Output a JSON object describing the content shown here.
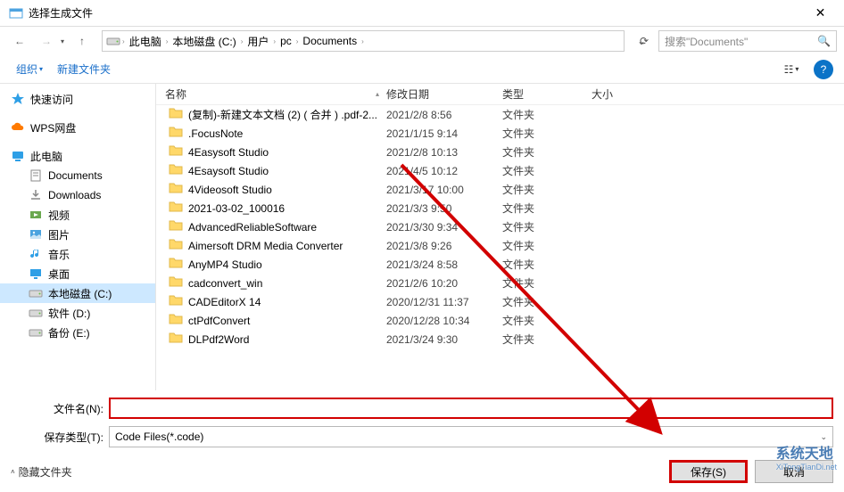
{
  "window": {
    "title": "选择生成文件",
    "close_icon": "✕"
  },
  "nav": {
    "back_icon": "←",
    "forward_icon": "→",
    "history_caret": "▾",
    "up_icon": "↑",
    "refresh_icon": "⟳",
    "address_dropdown": "⌄",
    "crumbs": [
      "此电脑",
      "本地磁盘 (C:)",
      "用户",
      "pc",
      "Documents"
    ],
    "search_placeholder": "搜索\"Documents\"",
    "search_icon": "🔍"
  },
  "toolbar": {
    "organize": "组织",
    "caret": "▾",
    "new_folder": "新建文件夹",
    "view_icon": "☷",
    "help_icon": "?"
  },
  "sidebar": {
    "items": [
      {
        "icon": "star",
        "color": "#2e9fe6",
        "label": "快速访问",
        "indent": 0
      },
      {
        "icon": "cloud",
        "color": "#ff7a00",
        "label": "WPS网盘",
        "indent": 0
      },
      {
        "icon": "pc",
        "color": "#2e9fe6",
        "label": "此电脑",
        "indent": 0
      },
      {
        "icon": "doc",
        "color": "#888",
        "label": "Documents",
        "indent": 1
      },
      {
        "icon": "dl",
        "color": "#888",
        "label": "Downloads",
        "indent": 1
      },
      {
        "icon": "video",
        "color": "#6aa84f",
        "label": "视频",
        "indent": 1
      },
      {
        "icon": "pic",
        "color": "#4aa3df",
        "label": "图片",
        "indent": 1
      },
      {
        "icon": "music",
        "color": "#2e9fe6",
        "label": "音乐",
        "indent": 1
      },
      {
        "icon": "desktop",
        "color": "#2e9fe6",
        "label": "桌面",
        "indent": 1
      },
      {
        "icon": "drive",
        "color": "#888",
        "label": "本地磁盘 (C:)",
        "indent": 1,
        "selected": true
      },
      {
        "icon": "drive",
        "color": "#888",
        "label": "软件 (D:)",
        "indent": 1
      },
      {
        "icon": "drive",
        "color": "#888",
        "label": "备份 (E:)",
        "indent": 1
      }
    ]
  },
  "columns": {
    "name": "名称",
    "date": "修改日期",
    "type": "类型",
    "size": "大小",
    "sort_indicator": "▴"
  },
  "rows": [
    {
      "name": "(复制)-新建文本文档 (2) ( 合并 ) .pdf-2...",
      "date": "2021/2/8 8:56",
      "type": "文件夹"
    },
    {
      "name": ".FocusNote",
      "date": "2021/1/15 9:14",
      "type": "文件夹"
    },
    {
      "name": "4Easysoft Studio",
      "date": "2021/2/8 10:13",
      "type": "文件夹"
    },
    {
      "name": "4Esaysoft Studio",
      "date": "2021/4/5 10:12",
      "type": "文件夹"
    },
    {
      "name": "4Videosoft Studio",
      "date": "2021/3/17 10:00",
      "type": "文件夹"
    },
    {
      "name": "2021-03-02_100016",
      "date": "2021/3/3 9:50",
      "type": "文件夹"
    },
    {
      "name": "AdvancedReliableSoftware",
      "date": "2021/3/30 9:34",
      "type": "文件夹"
    },
    {
      "name": "Aimersoft DRM Media Converter",
      "date": "2021/3/8 9:26",
      "type": "文件夹"
    },
    {
      "name": "AnyMP4 Studio",
      "date": "2021/3/24 8:58",
      "type": "文件夹"
    },
    {
      "name": "cadconvert_win",
      "date": "2021/2/6 10:20",
      "type": "文件夹"
    },
    {
      "name": "CADEditorX 14",
      "date": "2020/12/31 11:37",
      "type": "文件夹"
    },
    {
      "name": "ctPdfConvert",
      "date": "2020/12/28 10:34",
      "type": "文件夹"
    },
    {
      "name": "DLPdf2Word",
      "date": "2021/3/24 9:30",
      "type": "文件夹"
    }
  ],
  "footer": {
    "filename_label": "文件名(N):",
    "filename_value": "",
    "type_label": "保存类型(T):",
    "type_value": "Code Files(*.code)",
    "hide_folders": "隐藏文件夹",
    "save": "保存(S)",
    "cancel": "取消"
  },
  "watermark": {
    "main": "系统天地",
    "sub": "XiTongTianDi.net"
  }
}
